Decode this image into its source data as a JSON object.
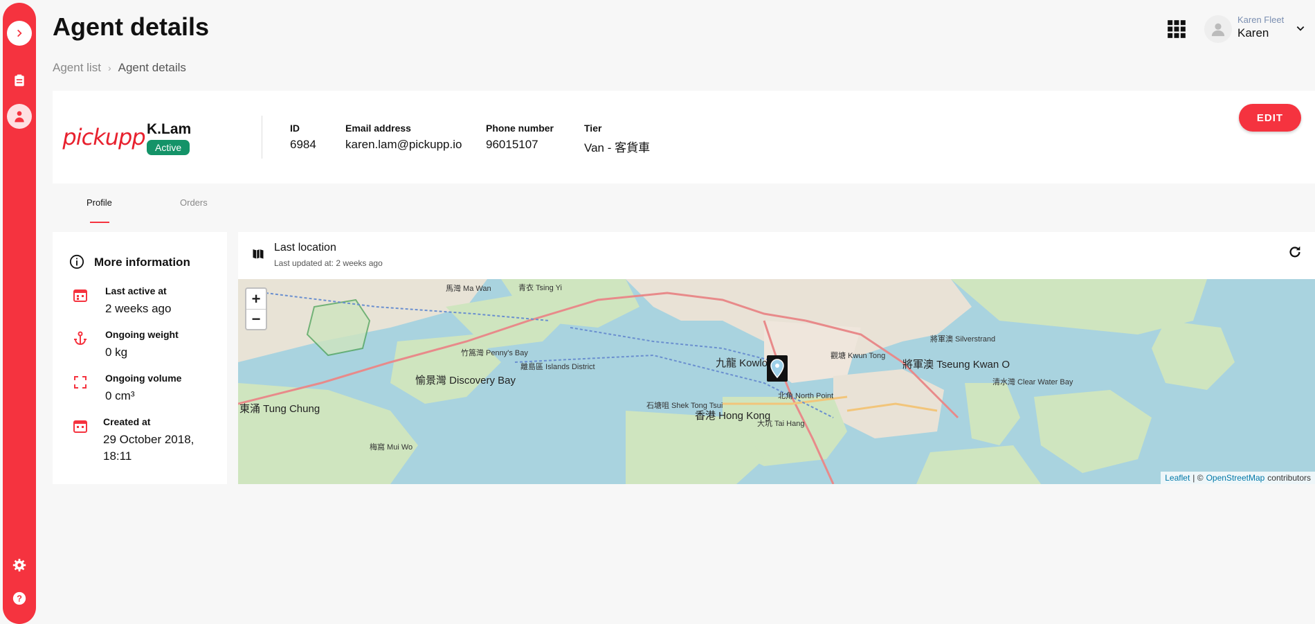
{
  "header": {
    "title": "Agent details",
    "user": {
      "org": "Karen Fleet",
      "name": "Karen"
    }
  },
  "breadcrumb": {
    "parent": "Agent list",
    "current": "Agent details"
  },
  "agent": {
    "logo_text": "pickupp",
    "name": "K.Lam",
    "status": "Active",
    "fields": [
      {
        "label": "ID",
        "value": "6984"
      },
      {
        "label": "Email address",
        "value": "karen.lam@pickupp.io"
      },
      {
        "label": "Phone number",
        "value": "96015107"
      },
      {
        "label": "Tier",
        "value": "Van - 客貨車"
      }
    ],
    "edit_label": "EDIT"
  },
  "tabs": [
    {
      "label": "Profile",
      "active": true
    },
    {
      "label": "Orders",
      "active": false
    }
  ],
  "more_info": {
    "title": "More information",
    "rows": [
      {
        "label": "Last active at",
        "value": "2 weeks ago",
        "icon": "calendar-icon"
      },
      {
        "label": "Ongoing weight",
        "value": "0 kg",
        "icon": "anchor-icon"
      },
      {
        "label": "Ongoing volume",
        "value": "0 cm³",
        "icon": "crop-icon"
      },
      {
        "label": "Created at",
        "value": "29 October 2018, 18:11",
        "icon": "calendar-icon"
      }
    ]
  },
  "location": {
    "title": "Last location",
    "subtitle": "Last updated at: 2 weeks ago",
    "zoom_in": "+",
    "zoom_out": "−",
    "attribution": {
      "leaflet": "Leaflet",
      "sep": "| ©",
      "osm": "OpenStreetMap",
      "suffix": "contributors"
    },
    "labels": [
      "九龍 Kowloon",
      "香港 Hong Kong",
      "將軍澳 Tseung Kwan O",
      "愉景灣 Discovery Bay",
      "東涌 Tung Chung",
      "青衣 Tsing Yi",
      "馬灣 Ma Wan",
      "竹篙灣 Penny's Bay",
      "石塘咀 Shek Tong Tsui",
      "大坑 Tai Hang",
      "北角 North Point",
      "離島區 Islands District",
      "梅窩 Mui Wo",
      "觀塘 Kwun Tong",
      "清水灣 Clear Water Bay",
      "將軍澳 Silverstrand"
    ]
  },
  "colors": {
    "brand": "#f5333f",
    "status_active": "#149368",
    "map_water": "#a9d3df"
  }
}
